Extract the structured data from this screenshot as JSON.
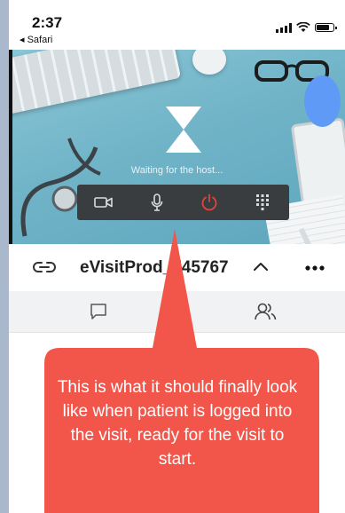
{
  "status_bar": {
    "time": "2:37",
    "back_app": "◂ Safari"
  },
  "video": {
    "waiting_text": "Waiting for the host...",
    "controls": [
      "video-camera-icon",
      "microphone-icon",
      "power-icon",
      "dialpad-icon"
    ],
    "end_color": "#e0443a"
  },
  "header": {
    "title": "eVisitProd_745767"
  },
  "tabs": {
    "chat": "chat-icon",
    "participants": "participants-icon"
  },
  "callout": {
    "text": "This is what it should finally look like when patient is logged into the visit, ready for the visit to start.",
    "color": "#f2564a"
  }
}
